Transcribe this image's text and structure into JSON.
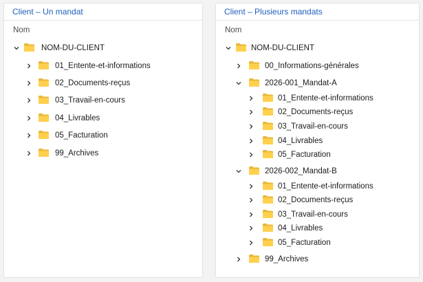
{
  "colors": {
    "title": "#1f5fbf",
    "folder_back": "#e9b73a",
    "folder_front": "#ffd04d"
  },
  "left": {
    "title": "Client – Un mandat",
    "column_header": "Nom",
    "root": {
      "label": "NOM-DU-CLIENT",
      "icon": "folder-icon",
      "state": "expanded"
    },
    "children": [
      {
        "label": "01_Entente-et-informations",
        "state": "collapsed"
      },
      {
        "label": "02_Documents-reçus",
        "state": "collapsed"
      },
      {
        "label": "03_Travail-en-cours",
        "state": "collapsed"
      },
      {
        "label": "04_Livrables",
        "state": "collapsed"
      },
      {
        "label": "05_Facturation",
        "state": "collapsed"
      },
      {
        "label": "99_Archives",
        "state": "collapsed"
      }
    ]
  },
  "right": {
    "title": "Client – Plusieurs mandats",
    "column_header": "Nom",
    "root": {
      "label": "NOM-DU-CLIENT",
      "icon": "folder-icon",
      "state": "expanded"
    },
    "general": {
      "label": "00_Informations-générales",
      "state": "collapsed"
    },
    "mandat_a": {
      "label": "2026-001_Mandat-A",
      "state": "expanded",
      "children": [
        {
          "label": "01_Entente-et-informations",
          "state": "collapsed"
        },
        {
          "label": "02_Documents-reçus",
          "state": "collapsed"
        },
        {
          "label": "03_Travail-en-cours",
          "state": "collapsed"
        },
        {
          "label": "04_Livrables",
          "state": "collapsed"
        },
        {
          "label": "05_Facturation",
          "state": "collapsed"
        }
      ]
    },
    "mandat_b": {
      "label": "2026-002_Mandat-B",
      "state": "expanded",
      "children": [
        {
          "label": "01_Entente-et-informations",
          "state": "collapsed"
        },
        {
          "label": "02_Documents-reçus",
          "state": "collapsed"
        },
        {
          "label": "03_Travail-en-cours",
          "state": "collapsed"
        },
        {
          "label": "04_Livrables",
          "state": "collapsed"
        },
        {
          "label": "05_Facturation",
          "state": "collapsed"
        }
      ]
    },
    "archives": {
      "label": "99_Archives",
      "state": "collapsed"
    }
  }
}
